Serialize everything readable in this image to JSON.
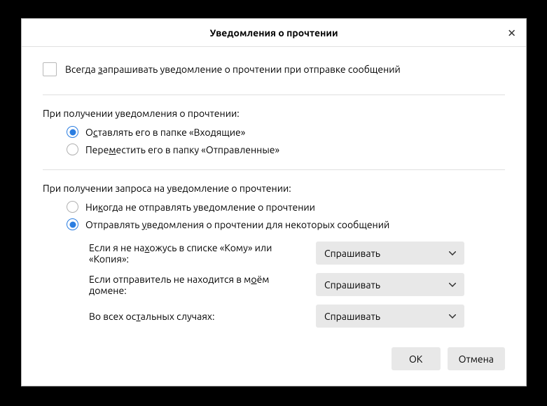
{
  "dialog": {
    "title": "Уведомления о прочтении"
  },
  "always_request": {
    "label_pre": "Всегда ",
    "label_u": "з",
    "label_post": "апрашивать уведомление о прочтении при отправке сообщений",
    "checked": false
  },
  "on_receipt_return": {
    "heading": "При получении уведомления о прочтении:",
    "option_inbox": {
      "pre": "О",
      "u": "с",
      "post": "тавлять его в папке «Входящие»"
    },
    "option_sent": {
      "pre": "Пере",
      "u": "м",
      "post": "естить его в папку «Отправленные»"
    },
    "selected": "inbox"
  },
  "on_receipt_request": {
    "heading": "При получении запроса на уведомление о прочтении:",
    "option_never": {
      "pre": "Ни",
      "u": "к",
      "post": "огда не отправлять уведомление о прочтении"
    },
    "option_some": {
      "pre": "Отправлять ",
      "u": "у",
      "post": "ведомления о прочтении для некоторых сообщений"
    },
    "selected": "some",
    "cond_not_in_to_cc": {
      "pre": "Если я не на",
      "u": "х",
      "post": "ожусь в списке «Кому» или «Копия»:",
      "value": "Спрашивать"
    },
    "cond_not_my_domain": {
      "pre": "Если отправитель не находится в м",
      "u": "о",
      "post": "ём домене:",
      "value": "Спрашивать"
    },
    "cond_other": {
      "pre": "Во всех ос",
      "u": "т",
      "post": "альных случаях:",
      "value": "Спрашивать"
    }
  },
  "buttons": {
    "ok": "OK",
    "cancel": "Отмена"
  }
}
